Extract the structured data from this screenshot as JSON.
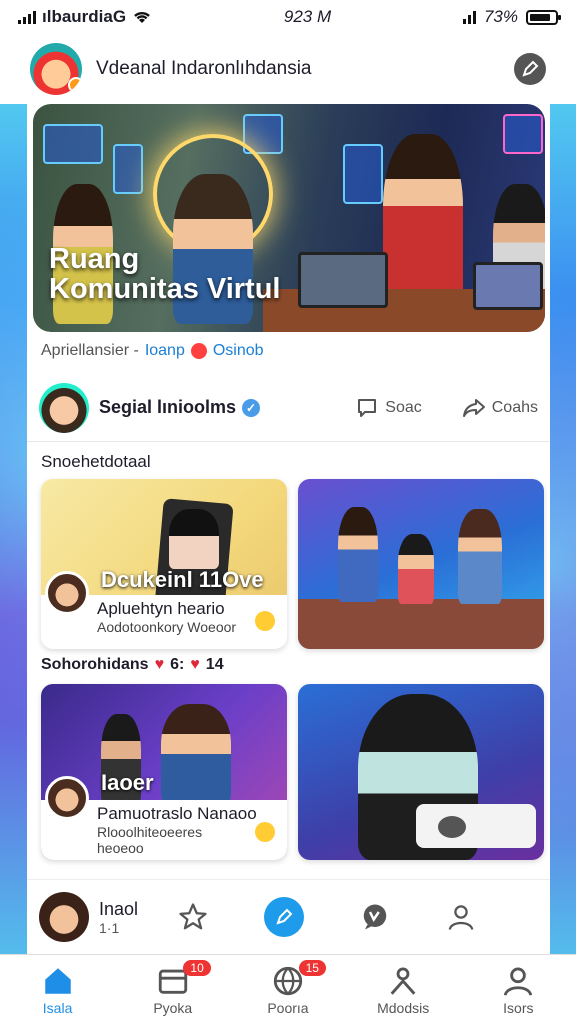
{
  "status_bar": {
    "carrier": "ılbaurdiaG",
    "time": "923 M",
    "battery": "73%"
  },
  "header": {
    "title": "Vdeanal Indaronlıhdansia",
    "edit_icon": "edit-icon"
  },
  "hero": {
    "caption_line1": "Ruang",
    "caption_line2": "Komunitas Virtul",
    "meta_text": "Apriellansier -",
    "meta_link1": "Ioanp",
    "meta_link2": "Osinob"
  },
  "post": {
    "name": "Segial lınioolms",
    "comment_label": "Soac",
    "share_label": "Coahs"
  },
  "section1": {
    "title": "Snoehetdotaal"
  },
  "cards_row1": [
    {
      "overlay": "Dcukeinl 11Ove",
      "title": "Apluehtyn heario",
      "subtitle": "Aodotoonkory Woeoor"
    },
    {
      "overlay": "",
      "title": "",
      "subtitle": ""
    }
  ],
  "section2": {
    "title": "Sohorohidans",
    "count1": "6:",
    "count2": "14"
  },
  "cards_row2": [
    {
      "overlay": "Iaoer",
      "title": "Pamuotraslo Nanaoo",
      "subtitle": "Rlooolhiteoeeres",
      "subtitle2": "heoeoo"
    },
    {
      "overlay": "",
      "title": "",
      "subtitle": ""
    }
  ],
  "bottom_card": {
    "name": "Inaol",
    "sub": "1·1"
  },
  "tabs": [
    {
      "label": "Isala",
      "icon": "home-icon",
      "active": true,
      "badge": ""
    },
    {
      "label": "Pyoka",
      "icon": "inbox-icon",
      "active": false,
      "badge": "10"
    },
    {
      "label": "Poorıa",
      "icon": "globe-icon",
      "active": false,
      "badge": "15"
    },
    {
      "label": "Mdodsis",
      "icon": "community-icon",
      "active": false,
      "badge": ""
    },
    {
      "label": "Isors",
      "icon": "profile-icon",
      "active": false,
      "badge": ""
    }
  ]
}
